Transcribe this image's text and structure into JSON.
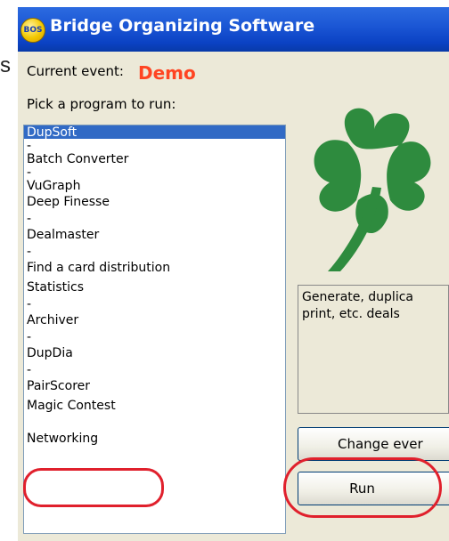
{
  "window": {
    "title": "Bridge Organizing Software",
    "logo_text": "BOS",
    "outside_fragment": "s"
  },
  "event": {
    "label": "Current event:",
    "name": "Demo"
  },
  "pick_label": "Pick a program to run:",
  "programs": [
    {
      "label": "DupSoft",
      "selected": true
    },
    {
      "label": "-"
    },
    {
      "label": "Batch Converter"
    },
    {
      "label": "-"
    },
    {
      "label": "VuGraph"
    },
    {
      "label": "Deep Finesse"
    },
    {
      "label": "-"
    },
    {
      "label": "Dealmaster"
    },
    {
      "label": "-"
    },
    {
      "label": "Find a card distribution"
    },
    {
      "label": "Statistics"
    },
    {
      "label": "-"
    },
    {
      "label": "Archiver"
    },
    {
      "label": "-"
    },
    {
      "label": "DupDia"
    },
    {
      "label": "-"
    },
    {
      "label": "PairScorer"
    },
    {
      "label": "Magic Contest"
    },
    {
      "label": "-"
    },
    {
      "label": "Networking"
    }
  ],
  "description": "Generate, duplica\nprint, etc. deals",
  "buttons": {
    "change_event": "Change ever",
    "run": "Run"
  },
  "colors": {
    "titlebar": "#0b42c4",
    "event_name": "#ff4422",
    "selection": "#316ac5",
    "clover": "#2e8b3e",
    "annotation": "#e0202c"
  },
  "icons": {
    "app_logo": "bos-logo-icon",
    "clover_logo": "four-leaf-clover-icon"
  }
}
